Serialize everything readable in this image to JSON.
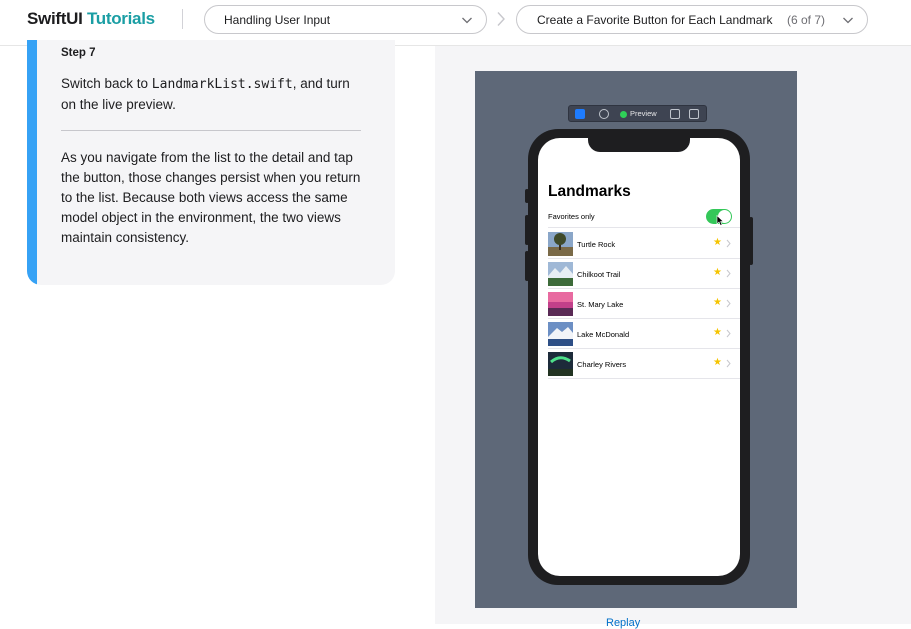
{
  "header": {
    "brand_part1": "SwiftUI",
    "brand_part2": "Tutorials",
    "chapter_select": "Handling User Input",
    "section_select": "Create a Favorite Button for Each Landmark",
    "section_counter": "(6 of 7)"
  },
  "step": {
    "title": "Step 7",
    "p1_before": "Switch back to ",
    "p1_code": "LandmarkList.swift",
    "p1_after": ", and turn on the live preview.",
    "p2": "As you navigate from the list to the detail and tap the button, those changes persist when you return to the list. Because both views access the same model object in the environment, the two views maintain consistency."
  },
  "preview": {
    "toolbar_label": "Preview",
    "list_title": "Landmarks",
    "favorites_label": "Favorites only",
    "favorites_on": true,
    "landmarks": [
      {
        "name": "Turtle Rock",
        "favorite": true
      },
      {
        "name": "Chilkoot Trail",
        "favorite": true
      },
      {
        "name": "St. Mary Lake",
        "favorite": true
      },
      {
        "name": "Lake McDonald",
        "favorite": true
      },
      {
        "name": "Charley Rivers",
        "favorite": true
      }
    ],
    "link_label": "Replay"
  },
  "colors": {
    "brand_accent": "#1a9ea4",
    "step_accent": "#36a2f5",
    "simulator_bg": "#5e6878",
    "toggle_on": "#34c759",
    "star": "#f5c400"
  }
}
